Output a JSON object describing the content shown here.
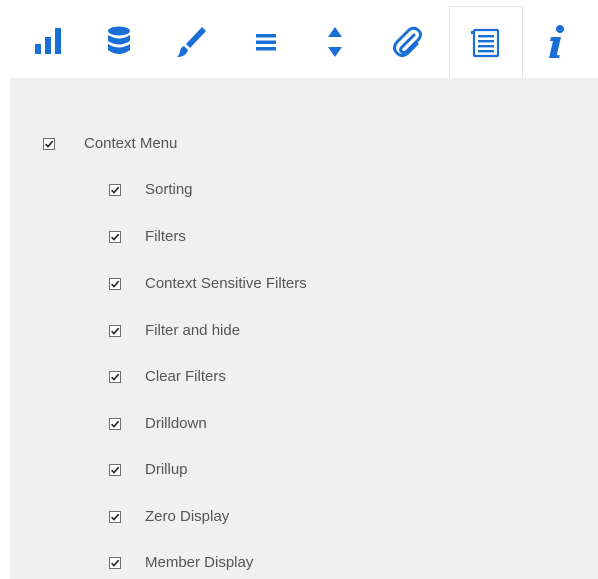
{
  "toolbar": {
    "accent_color": "#1a6ed8",
    "tabs": [
      {
        "icon": "bar-chart-icon",
        "active": false
      },
      {
        "icon": "database-icon",
        "active": false
      },
      {
        "icon": "paintbrush-icon",
        "active": false
      },
      {
        "icon": "menu-lines-icon",
        "active": false
      },
      {
        "icon": "sort-arrows-icon",
        "active": false
      },
      {
        "icon": "paperclip-icon",
        "active": false
      },
      {
        "icon": "list-icon",
        "active": true
      },
      {
        "icon": "info-icon",
        "active": false
      }
    ]
  },
  "context_menu": {
    "label": "Context Menu",
    "checked": true,
    "options": [
      {
        "label": "Sorting",
        "checked": true
      },
      {
        "label": "Filters",
        "checked": true
      },
      {
        "label": "Context Sensitive Filters",
        "checked": true
      },
      {
        "label": "Filter and hide",
        "checked": true
      },
      {
        "label": "Clear Filters",
        "checked": true
      },
      {
        "label": "Drilldown",
        "checked": true
      },
      {
        "label": "Drillup",
        "checked": true
      },
      {
        "label": "Zero Display",
        "checked": true
      },
      {
        "label": "Member Display",
        "checked": true
      }
    ]
  }
}
